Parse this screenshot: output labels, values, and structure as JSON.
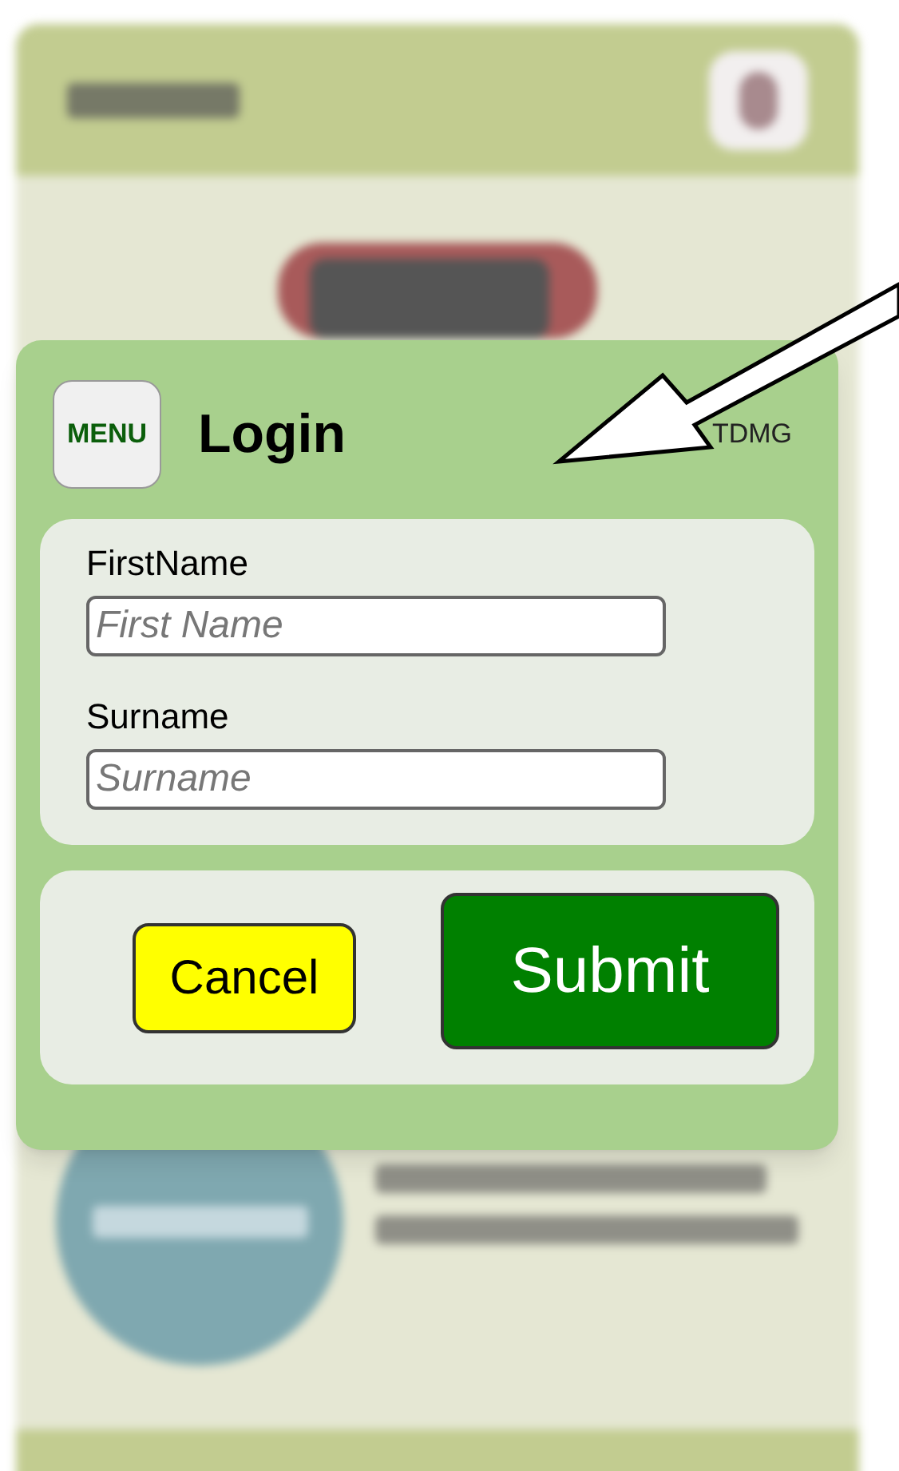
{
  "login_dialog": {
    "menu_button": "MENU",
    "title": "Login",
    "brand": "TDMG",
    "fields": [
      {
        "label": "FirstName",
        "placeholder": "First Name"
      },
      {
        "label": "Surname",
        "placeholder": "Surname"
      }
    ],
    "buttons": [
      {
        "kind": "cancel",
        "label": "Cancel"
      },
      {
        "kind": "submit",
        "label": "Submit"
      }
    ]
  }
}
